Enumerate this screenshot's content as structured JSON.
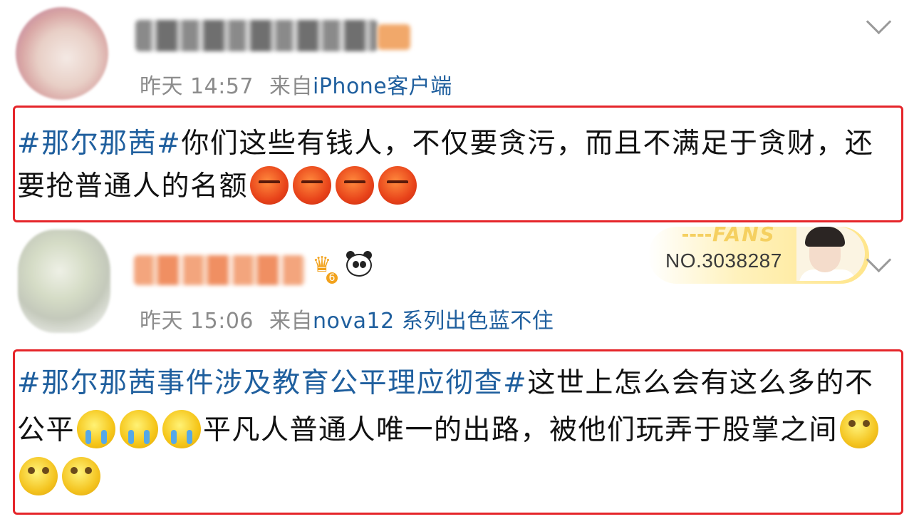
{
  "comments": [
    {
      "meta": {
        "time": "昨天 14:57",
        "from_prefix": "来自",
        "source": "iPhone客户端"
      },
      "content": {
        "hashtag": "#那尔那茜#",
        "text1": "你们这些有钱人，不仅要贪污，而且不满足于贪财，还要抢普通人的名额",
        "emojis": [
          "angry-face",
          "angry-face",
          "angry-face",
          "angry-face"
        ]
      }
    },
    {
      "meta": {
        "time": "昨天 15:06",
        "from_prefix": "来自",
        "source": "nova12 系列出色蓝不住"
      },
      "badges": {
        "crown_level": "6"
      },
      "fans_card": {
        "label": "FANS",
        "number": "NO.3038287"
      },
      "content": {
        "hashtag": "#那尔那茜事件涉及教育公平理应彻查#",
        "text1": "这世上怎么会有这么多的不公平",
        "text2": "平凡人普通人唯一的出路，被他们玩弄于股掌之间",
        "emojis_crying": [
          "crying-face",
          "crying-face",
          "crying-face"
        ],
        "emojis_eyeroll": [
          "eye-roll-face",
          "eye-roll-face",
          "eye-roll-face"
        ]
      }
    }
  ],
  "colors": {
    "highlight_box": "#e5252a",
    "link": "#1f5f9e",
    "meta": "#8c8c8c"
  }
}
